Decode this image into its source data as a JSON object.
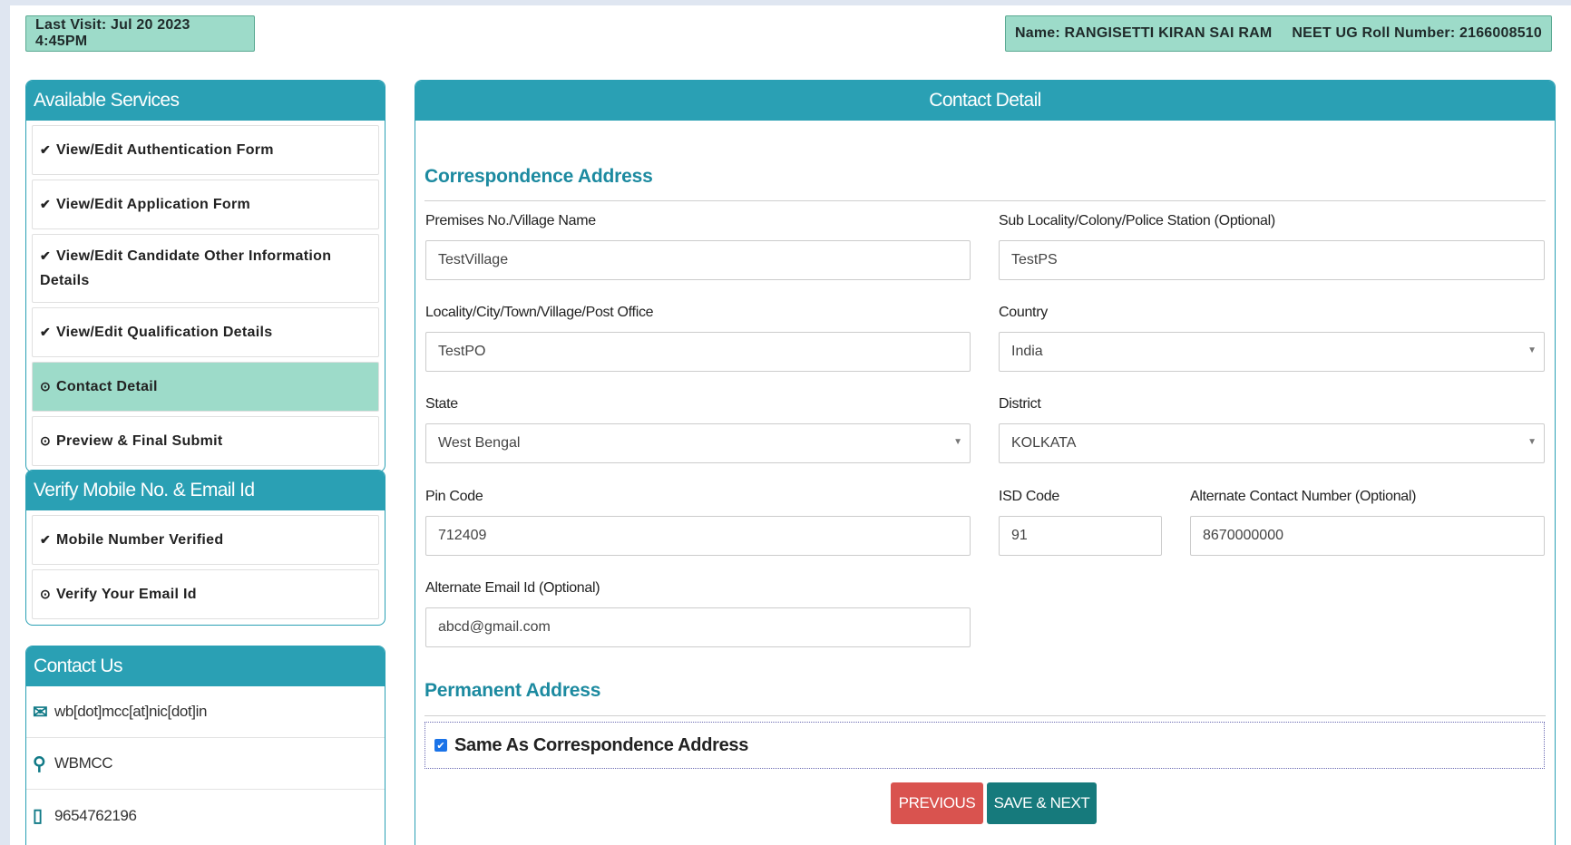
{
  "header": {
    "last_visit": "Last Visit: Jul 20 2023 4:45PM",
    "name": "Name: RANGISETTI KIRAN SAI RAM",
    "roll": "NEET UG Roll Number: 2166008510"
  },
  "services": {
    "title": "Available Services",
    "items": [
      {
        "icon": "check-circle-icon",
        "glyph": "✔",
        "label": "View/Edit Authentication Form"
      },
      {
        "icon": "check-circle-icon",
        "glyph": "✔",
        "label": "View/Edit Application Form"
      },
      {
        "icon": "check-circle-icon",
        "glyph": "✔",
        "label": "View/Edit Candidate Other Information Details"
      },
      {
        "icon": "check-circle-icon",
        "glyph": "✔",
        "label": "View/Edit Qualification Details"
      },
      {
        "icon": "clock-icon",
        "glyph": "⊙",
        "label": "Contact Detail"
      },
      {
        "icon": "clock-icon",
        "glyph": "⊙",
        "label": "Preview & Final Submit"
      }
    ]
  },
  "verify": {
    "title": "Verify Mobile No. & Email Id",
    "items": [
      {
        "icon": "check-circle-icon",
        "glyph": "✔",
        "label": "Mobile Number Verified"
      },
      {
        "icon": "clock-icon",
        "glyph": "⊙",
        "label": "Verify Your Email Id"
      }
    ]
  },
  "contact_us": {
    "title": "Contact Us",
    "email": "wb[dot]mcc[at]nic[dot]in",
    "location": "WBMCC",
    "phone": "9654762196"
  },
  "main": {
    "title": "Contact Detail",
    "correspondence_title": "Correspondence Address",
    "permanent_title": "Permanent Address",
    "fields": {
      "premises_label": "Premises No./Village Name",
      "premises_value": "TestVillage",
      "sublocality_label": "Sub Locality/Colony/Police Station (Optional)",
      "sublocality_value": "TestPS",
      "locality_label": "Locality/City/Town/Village/Post Office",
      "locality_value": "TestPO",
      "country_label": "Country",
      "country_value": "India",
      "state_label": "State",
      "state_value": "West Bengal",
      "district_label": "District",
      "district_value": "KOLKATA",
      "pin_label": "Pin Code",
      "pin_value": "712409",
      "isd_label": "ISD Code",
      "isd_value": "91",
      "alt_contact_label": "Alternate Contact Number (Optional)",
      "alt_contact_value": "8670000000",
      "alt_email_label": "Alternate Email Id (Optional)",
      "alt_email_value": "abcd@gmail.com"
    },
    "same_as_label": "Same As Correspondence Address",
    "same_as_checked": true,
    "previous_label": "PREVIOUS",
    "save_next_label": "SAVE & NEXT"
  }
}
